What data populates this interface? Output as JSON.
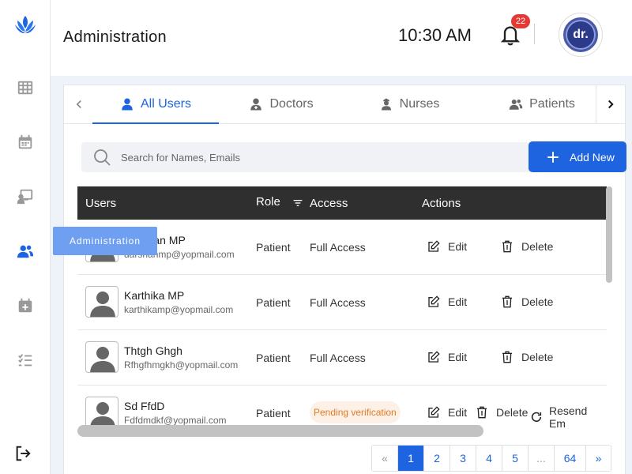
{
  "header": {
    "title": "Administration",
    "time": "10:30 AM",
    "notification_count": "22",
    "avatar_text": "dr."
  },
  "sidebar": {
    "tooltip": "Administration",
    "items": [
      {
        "name": "dashboard",
        "icon": "table-icon"
      },
      {
        "name": "calendar",
        "icon": "calendar-icon"
      },
      {
        "name": "presentation",
        "icon": "presentation-icon"
      },
      {
        "name": "administration",
        "icon": "users-icon",
        "active": true
      },
      {
        "name": "appointments",
        "icon": "calendar-plus-icon"
      },
      {
        "name": "tasks",
        "icon": "checklist-icon"
      },
      {
        "name": "logout",
        "icon": "logout-icon"
      }
    ]
  },
  "tabs": [
    {
      "label": "All Users",
      "icon": "user-icon",
      "active": true
    },
    {
      "label": "Doctors",
      "icon": "doctor-icon"
    },
    {
      "label": "Nurses",
      "icon": "nurse-icon"
    },
    {
      "label": "Patients",
      "icon": "users-icon"
    }
  ],
  "search": {
    "placeholder": "Search for Names, Emails"
  },
  "add_button": {
    "label": "Add New"
  },
  "table": {
    "headers": {
      "users": "Users",
      "role": "Role",
      "access": "Access",
      "actions": "Actions"
    },
    "rows": [
      {
        "name": "Darshan MP",
        "email": "darshanmp@yopmail.com",
        "role": "Patient",
        "access": "Full Access",
        "pending": false
      },
      {
        "name": "Karthika MP",
        "email": "karthikamp@yopmail.com",
        "role": "Patient",
        "access": "Full Access",
        "pending": false
      },
      {
        "name": "Thtgh Ghgh",
        "email": "Rfhgfhmgkh@yopmail.com",
        "role": "Patient",
        "access": "Full Access",
        "pending": false
      },
      {
        "name": "Sd FfdD",
        "email": "Fdfdmdkf@yopmail.com",
        "role": "Patient",
        "access": "Pending verification",
        "pending": true
      }
    ],
    "edit_label": "Edit",
    "delete_label": "Delete",
    "resend_label": "Resend Em"
  },
  "pagination": {
    "prev": "«",
    "pages": [
      "1",
      "2",
      "3",
      "4",
      "5",
      "...",
      "64"
    ],
    "current": "1",
    "next": "»"
  },
  "colors": {
    "accent": "#1e63e0",
    "pending_bg": "#fdf0e6",
    "pending_text": "#e07d24",
    "badge": "#e53935",
    "table_header": "#2f2f2f"
  }
}
